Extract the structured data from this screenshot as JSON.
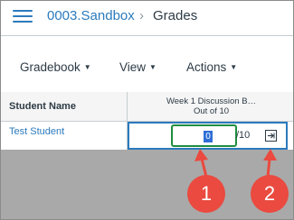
{
  "header": {
    "course": "0003.Sandbox",
    "separator": "›",
    "page": "Grades"
  },
  "toolbar": {
    "gradebook": "Gradebook",
    "view": "View",
    "actions": "Actions",
    "caret": "▼"
  },
  "grid": {
    "student_header": "Student Name",
    "assignment_title": "Week 1 Discussion B…",
    "assignment_points": "Out of 10",
    "student_name": "Test Student",
    "grade_value": "0",
    "out_of": "/10"
  },
  "annotations": {
    "marker_1": "1",
    "marker_2": "2"
  },
  "colors": {
    "link": "#2b7abc",
    "focus": "#1e8e3e",
    "marker": "#ea4a3f"
  }
}
